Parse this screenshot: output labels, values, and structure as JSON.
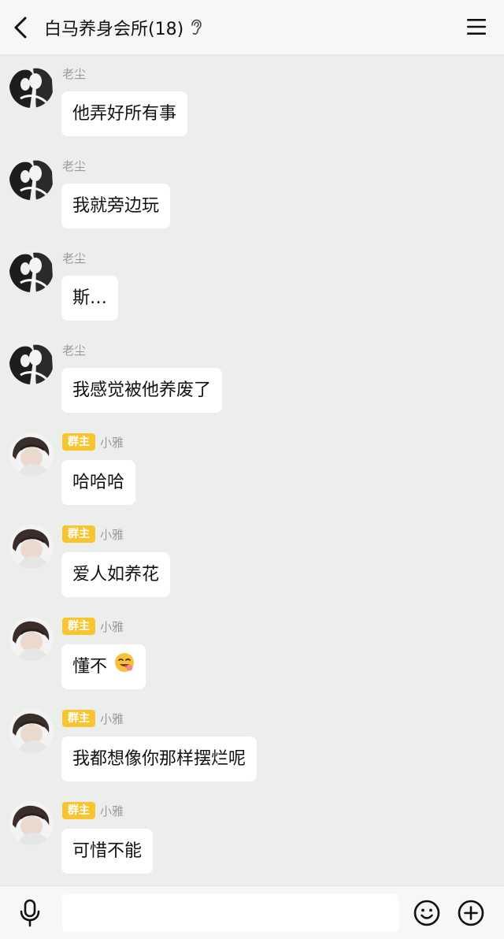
{
  "header": {
    "title": "白马养身会所(18)"
  },
  "owner_badge": "群主",
  "messages": [
    {
      "sender": "老尘",
      "text": "他弄好所有事",
      "avatar": "manga-avatar"
    },
    {
      "sender": "老尘",
      "text": "我就旁边玩",
      "avatar": "manga-avatar"
    },
    {
      "sender": "老尘",
      "text": "斯…",
      "avatar": "manga-avatar"
    },
    {
      "sender": "老尘",
      "text": "我感觉被他养废了",
      "avatar": "manga-avatar"
    },
    {
      "sender": "小雅",
      "text": "哈哈哈",
      "avatar": "girl-avatar",
      "is_owner": true
    },
    {
      "sender": "小雅",
      "text": "爱人如养花",
      "avatar": "girl-avatar",
      "is_owner": true
    },
    {
      "sender": "小雅",
      "text": "懂不",
      "avatar": "girl-avatar",
      "is_owner": true,
      "emoji": "yum-face-emoji"
    },
    {
      "sender": "小雅",
      "text": "我都想像你那样摆烂呢",
      "avatar": "girl-avatar",
      "is_owner": true
    },
    {
      "sender": "小雅",
      "text": "可惜不能",
      "avatar": "girl-avatar",
      "is_owner": true
    }
  ],
  "composer": {
    "value": "",
    "placeholder": ""
  },
  "colors": {
    "header_bg": "#f7f7f7",
    "chat_bg": "#eceeeb",
    "bubble_bg": "#ffffff",
    "owner_badge_bg": "#f7c531",
    "sender_text": "#9a9a9a"
  },
  "icons": {
    "back": "chevron-left-icon",
    "ear": "ear-icon",
    "menu": "hamburger-menu-icon",
    "mic": "microphone-icon",
    "emoji": "smiley-icon",
    "plus": "plus-circle-icon"
  }
}
